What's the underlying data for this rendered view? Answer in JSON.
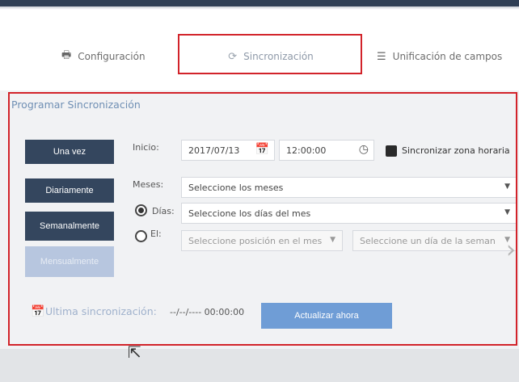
{
  "tabs": [
    {
      "label": "Configuración",
      "icon": "printer-icon"
    },
    {
      "label": "Sincronización",
      "icon": "refresh-icon"
    },
    {
      "label": "Unificación de campos",
      "icon": "list-icon"
    }
  ],
  "section": {
    "title": "Programar Sincronización"
  },
  "frequency": {
    "buttons": [
      {
        "label": "Una vez"
      },
      {
        "label": "Diariamente"
      },
      {
        "label": "Semanalmente"
      },
      {
        "label": "Mensualmente"
      }
    ]
  },
  "schedule": {
    "start_label": "Inicio:",
    "date": "2017/07/13",
    "time": "12:00:00",
    "timezone_label": "Sincronizar zona horaria",
    "months_label": "Meses:",
    "months_placeholder": "Seleccione los meses",
    "days_label": "Días:",
    "days_placeholder": "Seleccione los días del mes",
    "on_label": "El:",
    "position_placeholder": "Seleccione posición en el mes",
    "weekday_placeholder": "Seleccione un día de la seman"
  },
  "sync": {
    "last_label": "Ultima sincronización:",
    "last_value": "--/--/---- 00:00:00",
    "update_label": "Actualizar ahora"
  }
}
